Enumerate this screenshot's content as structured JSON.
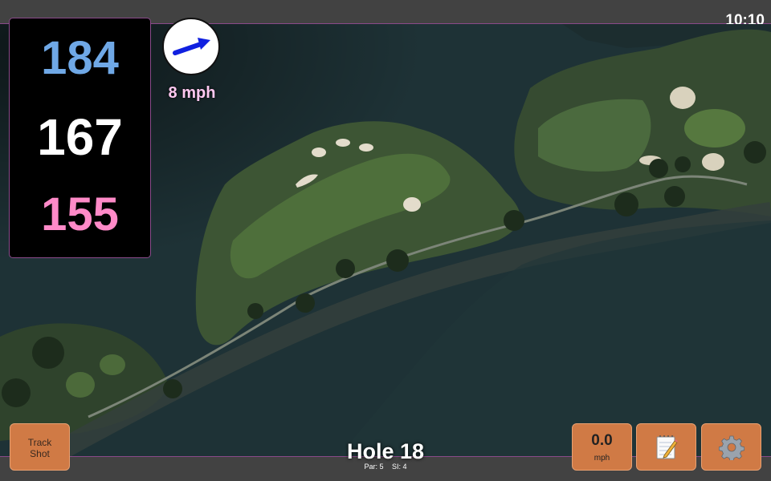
{
  "status": {
    "time": "10:10"
  },
  "yardage": {
    "back": "184",
    "middle": "167",
    "front": "155"
  },
  "wind": {
    "speed": "8 mph",
    "icon": "wind-direction-arrow-icon"
  },
  "hole": {
    "title": "Hole 18",
    "par": "Par: 5",
    "si": "SI: 4"
  },
  "buttons": {
    "track_shot": [
      "Track",
      "Shot"
    ],
    "speed_value": "0.0",
    "speed_unit": "mph",
    "notes_icon": "notepad-icon",
    "settings_icon": "gear-icon"
  },
  "colors": {
    "back": "#6fa8e6",
    "middle": "#ffffff",
    "front": "#ff8ac8",
    "button": "#d07a45",
    "wind_text": "#ffc8f0",
    "accent_border": "#8a4a8a"
  }
}
